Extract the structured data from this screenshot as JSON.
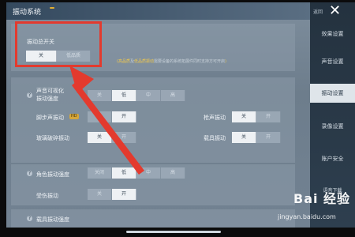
{
  "header": {
    "title": "振动系统",
    "badge": ""
  },
  "master_section": {
    "label": "振动总开关",
    "options": [
      "关",
      "低品质"
    ],
    "selected": 0,
    "note_highlight_1": "高品质",
    "note_mid": "及",
    "note_highlight_2": "低品质振动",
    "note_rest": "需要设备的系统拓展件同时支持方可开启"
  },
  "rows": {
    "sound_viz": {
      "label_line1": "声音可视化",
      "label_line2": "振动强度",
      "options": [
        "关",
        "低",
        "中",
        "高"
      ],
      "selected": 1
    },
    "footstep": {
      "label": "脚步声振动",
      "badge": "HD",
      "options": [
        "关",
        "开"
      ],
      "selected": 1
    },
    "gunshot": {
      "label": "枪声振动",
      "options": [
        "关",
        "开"
      ],
      "selected": 0
    },
    "glass": {
      "label": "玻璃破碎振动",
      "options": [
        "关",
        "开"
      ],
      "selected": 0
    },
    "vehicle": {
      "label": "载具振动",
      "options": [
        "关",
        "开"
      ],
      "selected": 0
    },
    "char_intensity": {
      "label": "角色振动强度",
      "options": [
        "关闭",
        "低",
        "中",
        "高"
      ],
      "selected": 1
    },
    "hit": {
      "label": "受伤振动",
      "options": [
        "关",
        "开"
      ],
      "selected": 1
    },
    "partial": {
      "label": "载具振动强度"
    }
  },
  "sidebar": {
    "return_label": "返回",
    "items": [
      "效果设置",
      "声音设置",
      "振动设置",
      "录像设置",
      "账户安全",
      "语音下载"
    ],
    "active_index": 2
  },
  "watermark": {
    "logo": "Bai 经验",
    "url": "jingyan.baidu.com"
  },
  "colors": {
    "highlight_box": "#e33a2e",
    "note_yellow": "#f2c94c"
  }
}
